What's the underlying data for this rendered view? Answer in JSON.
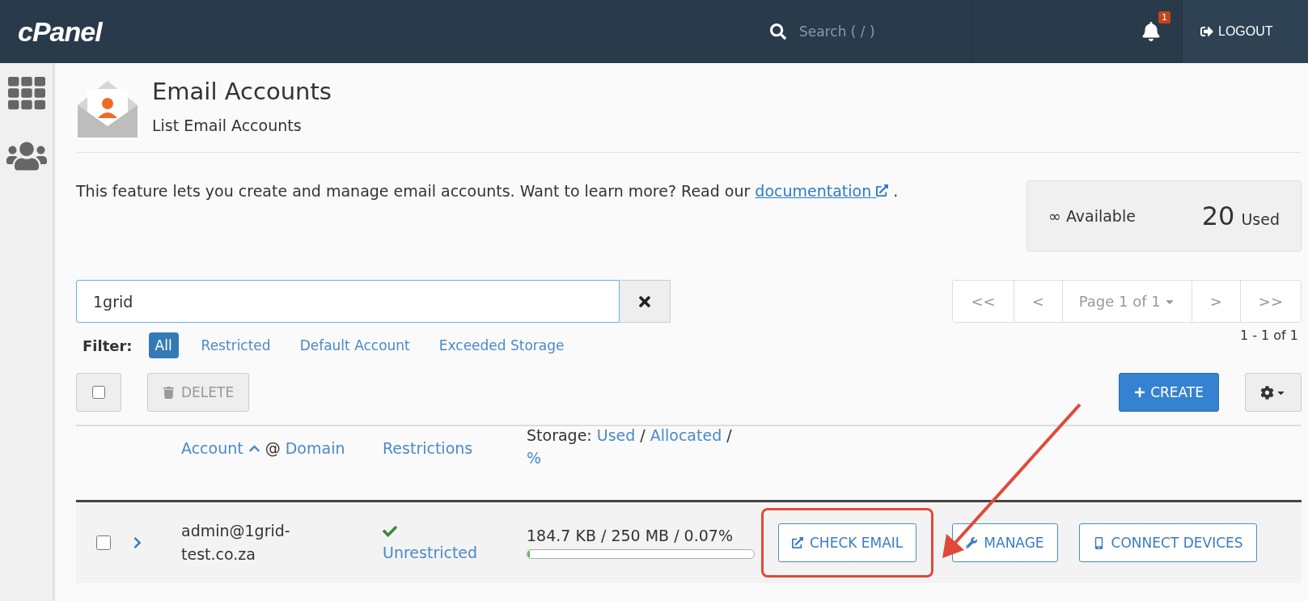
{
  "header": {
    "logo": "cPanel",
    "search_placeholder": "Search ( / )",
    "notification_count": "1",
    "logout": "LOGOUT"
  },
  "page": {
    "title": "Email Accounts",
    "subtitle": "List Email Accounts"
  },
  "description": {
    "text": "This feature lets you create and manage email accounts. Want to learn more? Read our",
    "link": "documentation",
    "end": "."
  },
  "stats": {
    "available_symbol": "∞",
    "available_label": "Available",
    "used_count": "20",
    "used_label": "Used"
  },
  "search": {
    "value": "1grid"
  },
  "pagination": {
    "first": "<<",
    "prev": "<",
    "page": "Page 1 of 1",
    "next": ">",
    "last": ">>",
    "range": "1 - 1 of 1"
  },
  "filter": {
    "label": "Filter:",
    "options": [
      {
        "label": "All",
        "selected": true
      },
      {
        "label": "Restricted",
        "selected": false
      },
      {
        "label": "Default Account",
        "selected": false
      },
      {
        "label": "Exceeded Storage",
        "selected": false
      }
    ]
  },
  "toolbar": {
    "select_all_checked": false,
    "delete": "DELETE",
    "delete_disabled": true,
    "create": "CREATE"
  },
  "table": {
    "account_column": {
      "account": "Account",
      "at": "@",
      "domain": "Domain"
    },
    "restrictions_column": "Restrictions",
    "storage_column": {
      "label": "Storage:",
      "used": "Used",
      "separators": [
        "/",
        "/"
      ],
      "allocated": "Allocated",
      "percent": "%"
    },
    "rows": [
      {
        "checked": false,
        "expanded": false,
        "address": "admin@1grid-test.co.za",
        "restriction": "Unrestricted",
        "storage": "184.7 KB / 250 MB / 0.07%",
        "level": 0.0007,
        "actions": [
          {
            "kind": "check_email",
            "label": "CHECK EMAIL",
            "highlighted": true
          },
          {
            "kind": "manage",
            "label": "MANAGE",
            "highlighted": false
          },
          {
            "kind": "connect",
            "label": "CONNECT DEVICES",
            "highlighted": false
          }
        ]
      }
    ]
  }
}
